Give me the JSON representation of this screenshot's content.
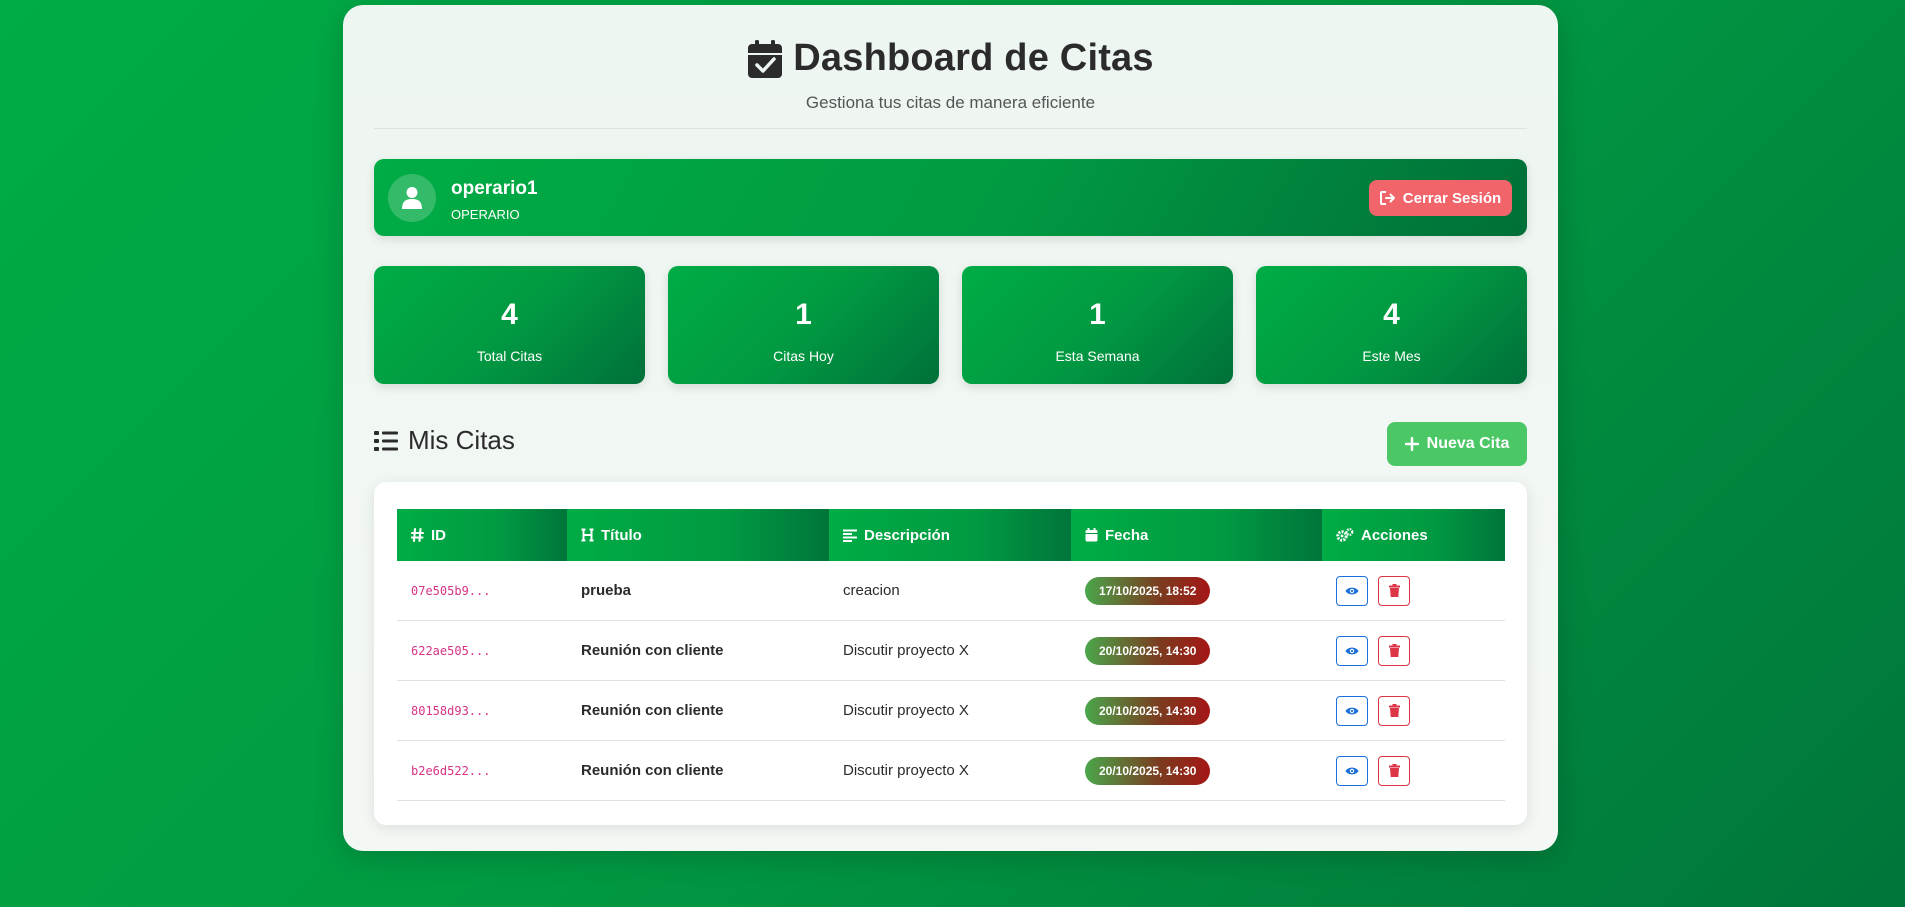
{
  "header": {
    "title": "Dashboard de Citas",
    "subtitle": "Gestiona tus citas de manera eficiente",
    "icon": "calendar-check-icon"
  },
  "user": {
    "name": "operario1",
    "role": "OPERARIO",
    "logout_label": "Cerrar Sesión"
  },
  "stats": [
    {
      "value": "4",
      "label": "Total Citas"
    },
    {
      "value": "1",
      "label": "Citas Hoy"
    },
    {
      "value": "1",
      "label": "Esta Semana"
    },
    {
      "value": "4",
      "label": "Este Mes"
    }
  ],
  "section": {
    "title": "Mis Citas",
    "new_button": "Nueva Cita"
  },
  "table": {
    "columns": [
      "ID",
      "Título",
      "Descripción",
      "Fecha",
      "Acciones"
    ],
    "rows": [
      {
        "id": "07e505b9...",
        "titulo": "prueba",
        "descripcion": "creacion",
        "fecha": "17/10/2025, 18:52"
      },
      {
        "id": "622ae505...",
        "titulo": "Reunión con cliente",
        "descripcion": "Discutir proyecto X",
        "fecha": "20/10/2025, 14:30"
      },
      {
        "id": "80158d93...",
        "titulo": "Reunión con cliente",
        "descripcion": "Discutir proyecto X",
        "fecha": "20/10/2025, 14:30"
      },
      {
        "id": "b2e6d522...",
        "titulo": "Reunión con cliente",
        "descripcion": "Discutir proyecto X",
        "fecha": "20/10/2025, 14:30"
      }
    ]
  },
  "colors": {
    "brand_green": "#019a42",
    "logout_red": "#f1656a",
    "new_button_green": "#4cc766",
    "id_pink": "#d63384",
    "view_blue": "#1a6fd8",
    "delete_red": "#dc3545"
  }
}
